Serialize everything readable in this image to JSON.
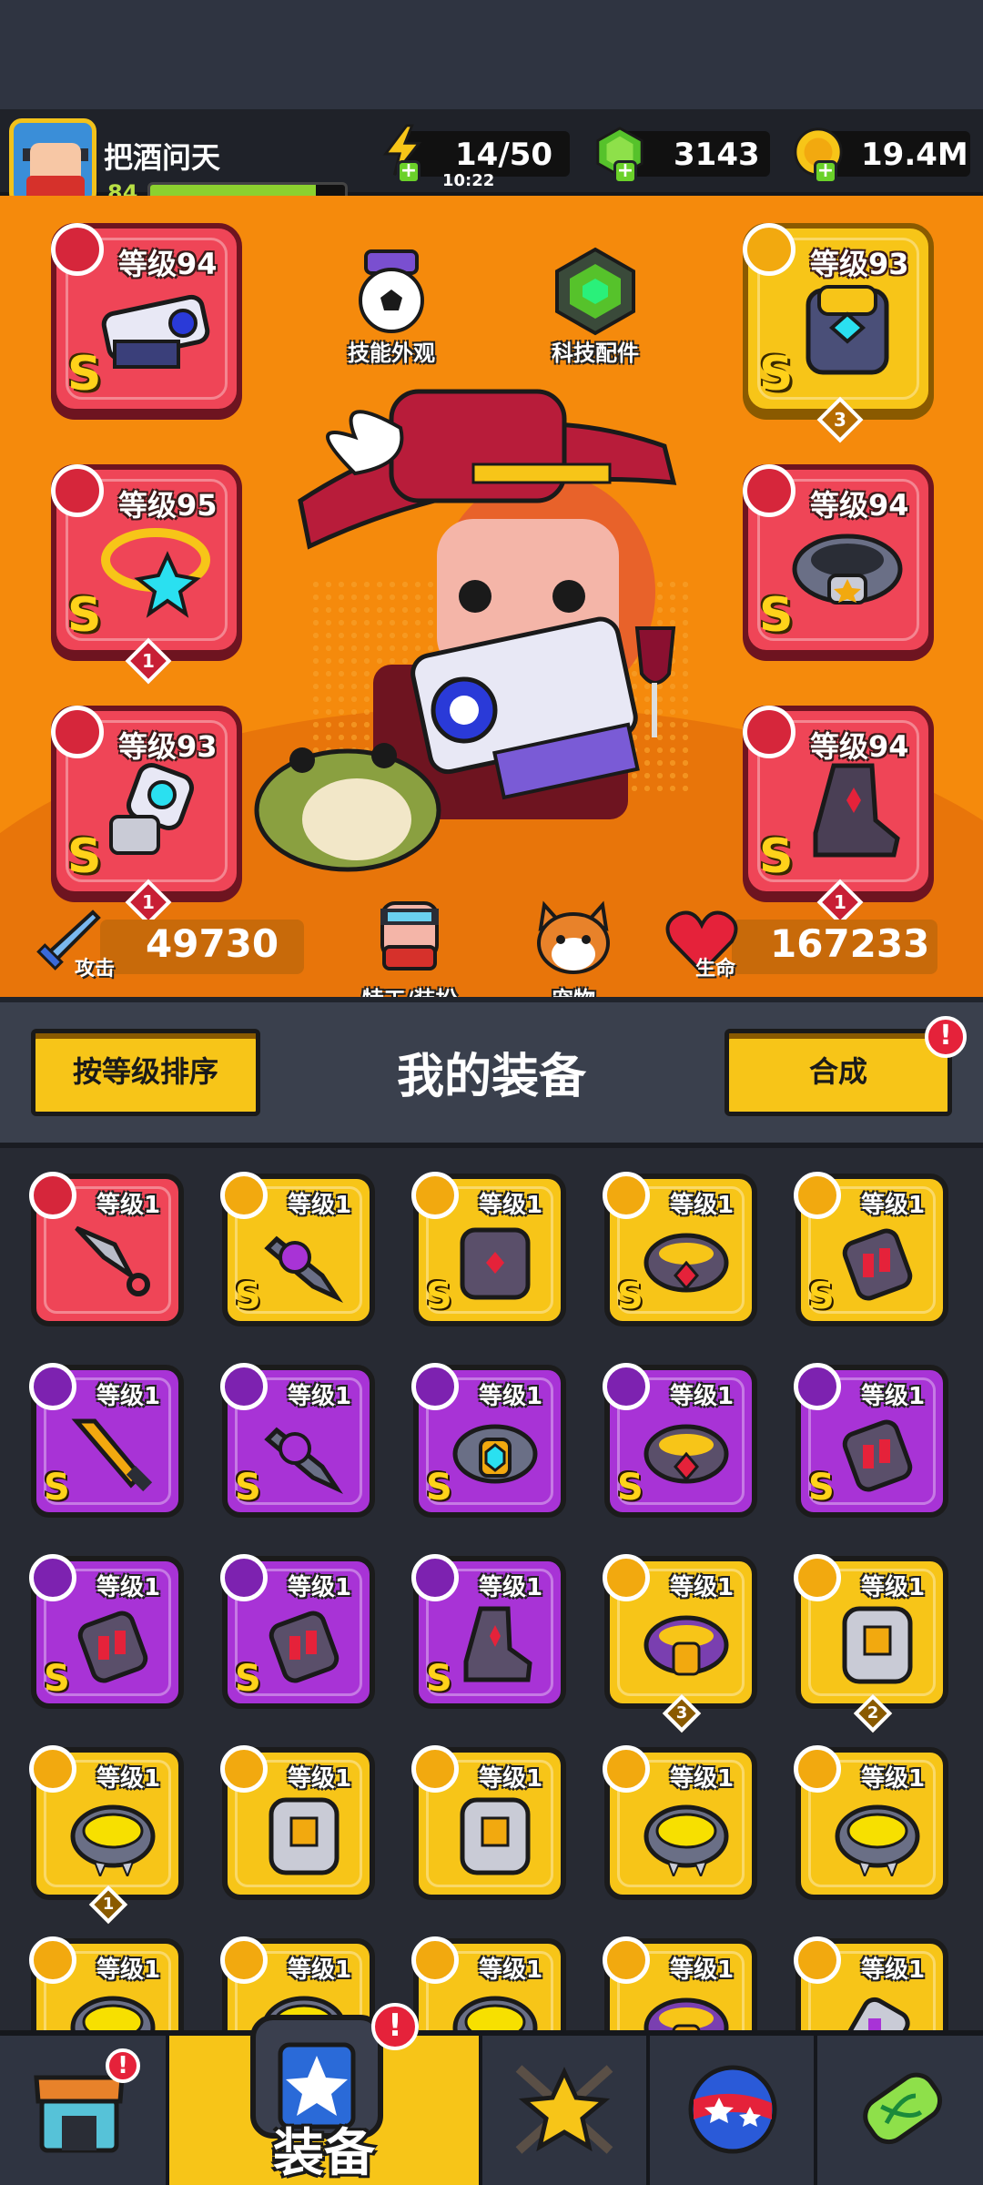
{
  "player": {
    "name": "把酒问天",
    "level": "84",
    "xp_fraction": 0.85
  },
  "resources": {
    "energy": "14/50",
    "energy_timer": "10:22",
    "gems": "3143",
    "gold": "19.4M"
  },
  "hero": {
    "slots": [
      {
        "level": "等级94",
        "grade": "S",
        "rarity": "red",
        "slot": "weapon",
        "count": null
      },
      {
        "level": "等级93",
        "grade": "S",
        "rarity": "gold",
        "slot": "armor",
        "count": "3"
      },
      {
        "level": "等级95",
        "grade": "S",
        "rarity": "red",
        "slot": "necklace",
        "count": "1"
      },
      {
        "level": "等级94",
        "grade": "S",
        "rarity": "red",
        "slot": "belt",
        "count": null
      },
      {
        "level": "等级93",
        "grade": "S",
        "rarity": "red",
        "slot": "gloves",
        "count": "1"
      },
      {
        "level": "等级94",
        "grade": "S",
        "rarity": "red",
        "slot": "boots",
        "count": "1"
      }
    ],
    "skill_skin_label": "技能外观",
    "tech_parts_label": "科技配件",
    "agent_label": "特工/装扮",
    "pet_label": "宠物",
    "attack_label": "攻击",
    "attack_value": "49730",
    "hp_label": "生命",
    "hp_value": "167233"
  },
  "equipment": {
    "sort_button": "按等级排序",
    "title": "我的装备",
    "merge_button": "合成",
    "merge_alert": "!",
    "items": [
      {
        "level": "等级1",
        "rarity": "red",
        "grade": "",
        "count": null,
        "icon": "kunai-icon"
      },
      {
        "level": "等级1",
        "rarity": "gold",
        "grade": "S",
        "count": null,
        "icon": "drill-blade-icon"
      },
      {
        "level": "等级1",
        "rarity": "gold",
        "grade": "S",
        "count": null,
        "icon": "dark-armor-icon"
      },
      {
        "level": "等级1",
        "rarity": "gold",
        "grade": "S",
        "count": null,
        "icon": "dark-belt-icon"
      },
      {
        "level": "等级1",
        "rarity": "gold",
        "grade": "S",
        "count": null,
        "icon": "dark-gauntlet-icon"
      },
      {
        "level": "等级1",
        "rarity": "purple",
        "grade": "S",
        "count": null,
        "icon": "flame-sword-icon"
      },
      {
        "level": "等级1",
        "rarity": "purple",
        "grade": "S",
        "count": null,
        "icon": "drill-blade-icon"
      },
      {
        "level": "等级1",
        "rarity": "purple",
        "grade": "S",
        "count": null,
        "icon": "gold-belt-icon"
      },
      {
        "level": "等级1",
        "rarity": "purple",
        "grade": "S",
        "count": null,
        "icon": "dark-belt-icon"
      },
      {
        "level": "等级1",
        "rarity": "purple",
        "grade": "S",
        "count": null,
        "icon": "dark-gauntlet-icon"
      },
      {
        "level": "等级1",
        "rarity": "purple",
        "grade": "S",
        "count": null,
        "icon": "dark-gauntlet-icon"
      },
      {
        "level": "等级1",
        "rarity": "purple",
        "grade": "S",
        "count": null,
        "icon": "dark-gauntlet-icon"
      },
      {
        "level": "等级1",
        "rarity": "purple",
        "grade": "S",
        "count": null,
        "icon": "dark-boot-icon"
      },
      {
        "level": "等级1",
        "rarity": "gold",
        "grade": "",
        "count": "3",
        "icon": "purple-belt-icon"
      },
      {
        "level": "等级1",
        "rarity": "gold",
        "grade": "",
        "count": "2",
        "icon": "steel-armor-icon"
      },
      {
        "level": "等级1",
        "rarity": "gold",
        "grade": "",
        "count": "1",
        "icon": "spiked-collar-icon"
      },
      {
        "level": "等级1",
        "rarity": "gold",
        "grade": "",
        "count": null,
        "icon": "steel-armor-icon"
      },
      {
        "level": "等级1",
        "rarity": "gold",
        "grade": "",
        "count": null,
        "icon": "steel-armor-icon"
      },
      {
        "level": "等级1",
        "rarity": "gold",
        "grade": "",
        "count": null,
        "icon": "spiked-collar-icon"
      },
      {
        "level": "等级1",
        "rarity": "gold",
        "grade": "",
        "count": null,
        "icon": "spiked-collar-icon"
      },
      {
        "level": "等级1",
        "rarity": "gold",
        "grade": "",
        "count": null,
        "icon": "spiked-collar-icon"
      },
      {
        "level": "等级1",
        "rarity": "gold",
        "grade": "",
        "count": null,
        "icon": "spiked-collar-icon"
      },
      {
        "level": "等级1",
        "rarity": "gold",
        "grade": "",
        "count": null,
        "icon": "spiked-collar-icon"
      },
      {
        "level": "等级1",
        "rarity": "gold",
        "grade": "",
        "count": null,
        "icon": "purple-belt-icon"
      },
      {
        "level": "等级1",
        "rarity": "gold",
        "grade": "",
        "count": null,
        "icon": "gauntlet-icon"
      }
    ]
  },
  "nav": {
    "equipment_label": "装备",
    "equipment_alert": "!",
    "shop_alert": "!"
  },
  "colors": {
    "hero_bg": "#f58a0c",
    "rarity_red": "#ef4557",
    "rarity_gold": "#f7c518",
    "rarity_purple": "#a833d6"
  }
}
